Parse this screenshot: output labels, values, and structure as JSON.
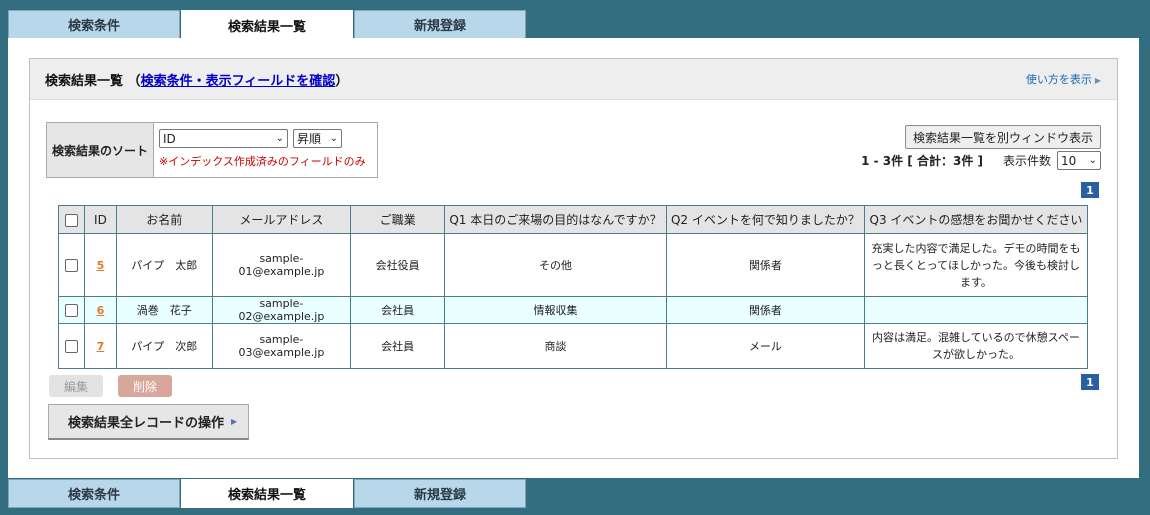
{
  "tabs": [
    "検索条件",
    "検索結果一覧",
    "新規登録"
  ],
  "active_tab": 1,
  "panel": {
    "title": "検索結果一覧",
    "title_open": "（",
    "title_link": "検索条件・表示フィールドを確認",
    "title_close": "）",
    "help_link": "使い方を表示"
  },
  "sort": {
    "label": "検索結果のソート",
    "field_value": "ID",
    "order_value": "昇順",
    "note": "※インデックス作成済みのフィールドのみ"
  },
  "controls": {
    "open_window_button": "検索結果一覧を別ウィンドウ表示",
    "count_text": "1 - 3件 [ 合計：3件 ]",
    "per_page_label": "表示件数",
    "per_page_value": "10",
    "page_number": "1"
  },
  "table": {
    "headers": [
      "ID",
      "お名前",
      "メールアドレス",
      "ご職業",
      "Q1 本日のご来場の目的はなんですか？",
      "Q2 イベントを何で知りましたか？",
      "Q3 イベントの感想をお聞かせください"
    ],
    "rows": [
      {
        "id": "5",
        "name": "パイプ　太郎",
        "email": "sample-01@example.jp",
        "job": "会社役員",
        "q1": "その他",
        "q2": "関係者",
        "q3": "充実した内容で満足した。デモの時間をもっと長くとってほしかった。今後も検討します。"
      },
      {
        "id": "6",
        "name": "渦巻　花子",
        "email": "sample-02@example.jp",
        "job": "会社員",
        "q1": "情報収集",
        "q2": "関係者",
        "q3": ""
      },
      {
        "id": "7",
        "name": "パイプ　次郎",
        "email": "sample-03@example.jp",
        "job": "会社員",
        "q1": "商談",
        "q2": "メール",
        "q3": "内容は満足。混雑しているので休憩スペースが欲しかった。"
      }
    ]
  },
  "actions": {
    "edit": "編集",
    "delete": "削除",
    "all_records": "検索結果全レコードの操作"
  },
  "colors": {
    "background": "#336e80",
    "tab": "#b9d7ea",
    "pager": "#2a5fa3",
    "id_link": "#e07b2e",
    "delete_button": "#d8a79b"
  }
}
